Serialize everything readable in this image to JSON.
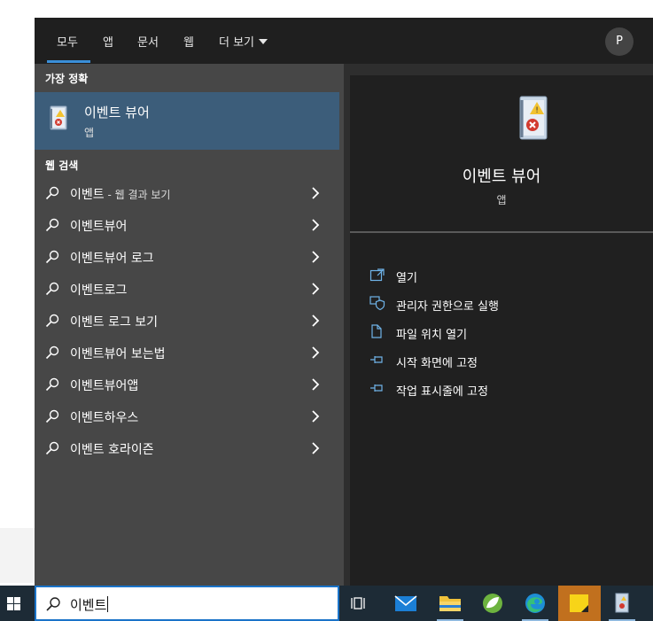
{
  "tabs": [
    {
      "label": "모두"
    },
    {
      "label": "앱"
    },
    {
      "label": "문서"
    },
    {
      "label": "웹"
    },
    {
      "label": "더 보기"
    }
  ],
  "user": {
    "initial": "P"
  },
  "best_match": {
    "section": "가장 정확",
    "title": "이벤트 뷰어",
    "type": "앱"
  },
  "web_search": {
    "section": "웹 검색",
    "items": [
      {
        "label": "이벤트",
        "suffix": " - 웹 결과 보기"
      },
      {
        "label": "이벤트뷰어",
        "suffix": ""
      },
      {
        "label": "이벤트뷰어 로그",
        "suffix": ""
      },
      {
        "label": "이벤트로그",
        "suffix": ""
      },
      {
        "label": "이벤트 로그 보기",
        "suffix": ""
      },
      {
        "label": "이벤트뷰어 보는법",
        "suffix": ""
      },
      {
        "label": "이벤트뷰어앱",
        "suffix": ""
      },
      {
        "label": "이벤트하우스",
        "suffix": ""
      },
      {
        "label": "이벤트 호라이즌",
        "suffix": ""
      }
    ]
  },
  "detail": {
    "title": "이벤트 뷰어",
    "type": "앱",
    "actions": [
      {
        "label": "열기",
        "icon": "open-icon"
      },
      {
        "label": "관리자 권한으로 실행",
        "icon": "shield-icon"
      },
      {
        "label": "파일 위치 열기",
        "icon": "file-location-icon"
      },
      {
        "label": "시작 화면에 고정",
        "icon": "pin-icon"
      },
      {
        "label": "작업 표시줄에 고정",
        "icon": "pin-icon"
      }
    ]
  },
  "taskbar": {
    "search_value": "이벤트",
    "apps": [
      "task-view",
      "mail",
      "file-explorer",
      "spring-app",
      "edge",
      "sticky-notes",
      "event-viewer"
    ]
  },
  "colors": {
    "accent": "#3a8fd9",
    "best_match_bg": "#3c5d7a",
    "taskbar_bg": "#1d2b36",
    "active_app": "#c1701e"
  }
}
